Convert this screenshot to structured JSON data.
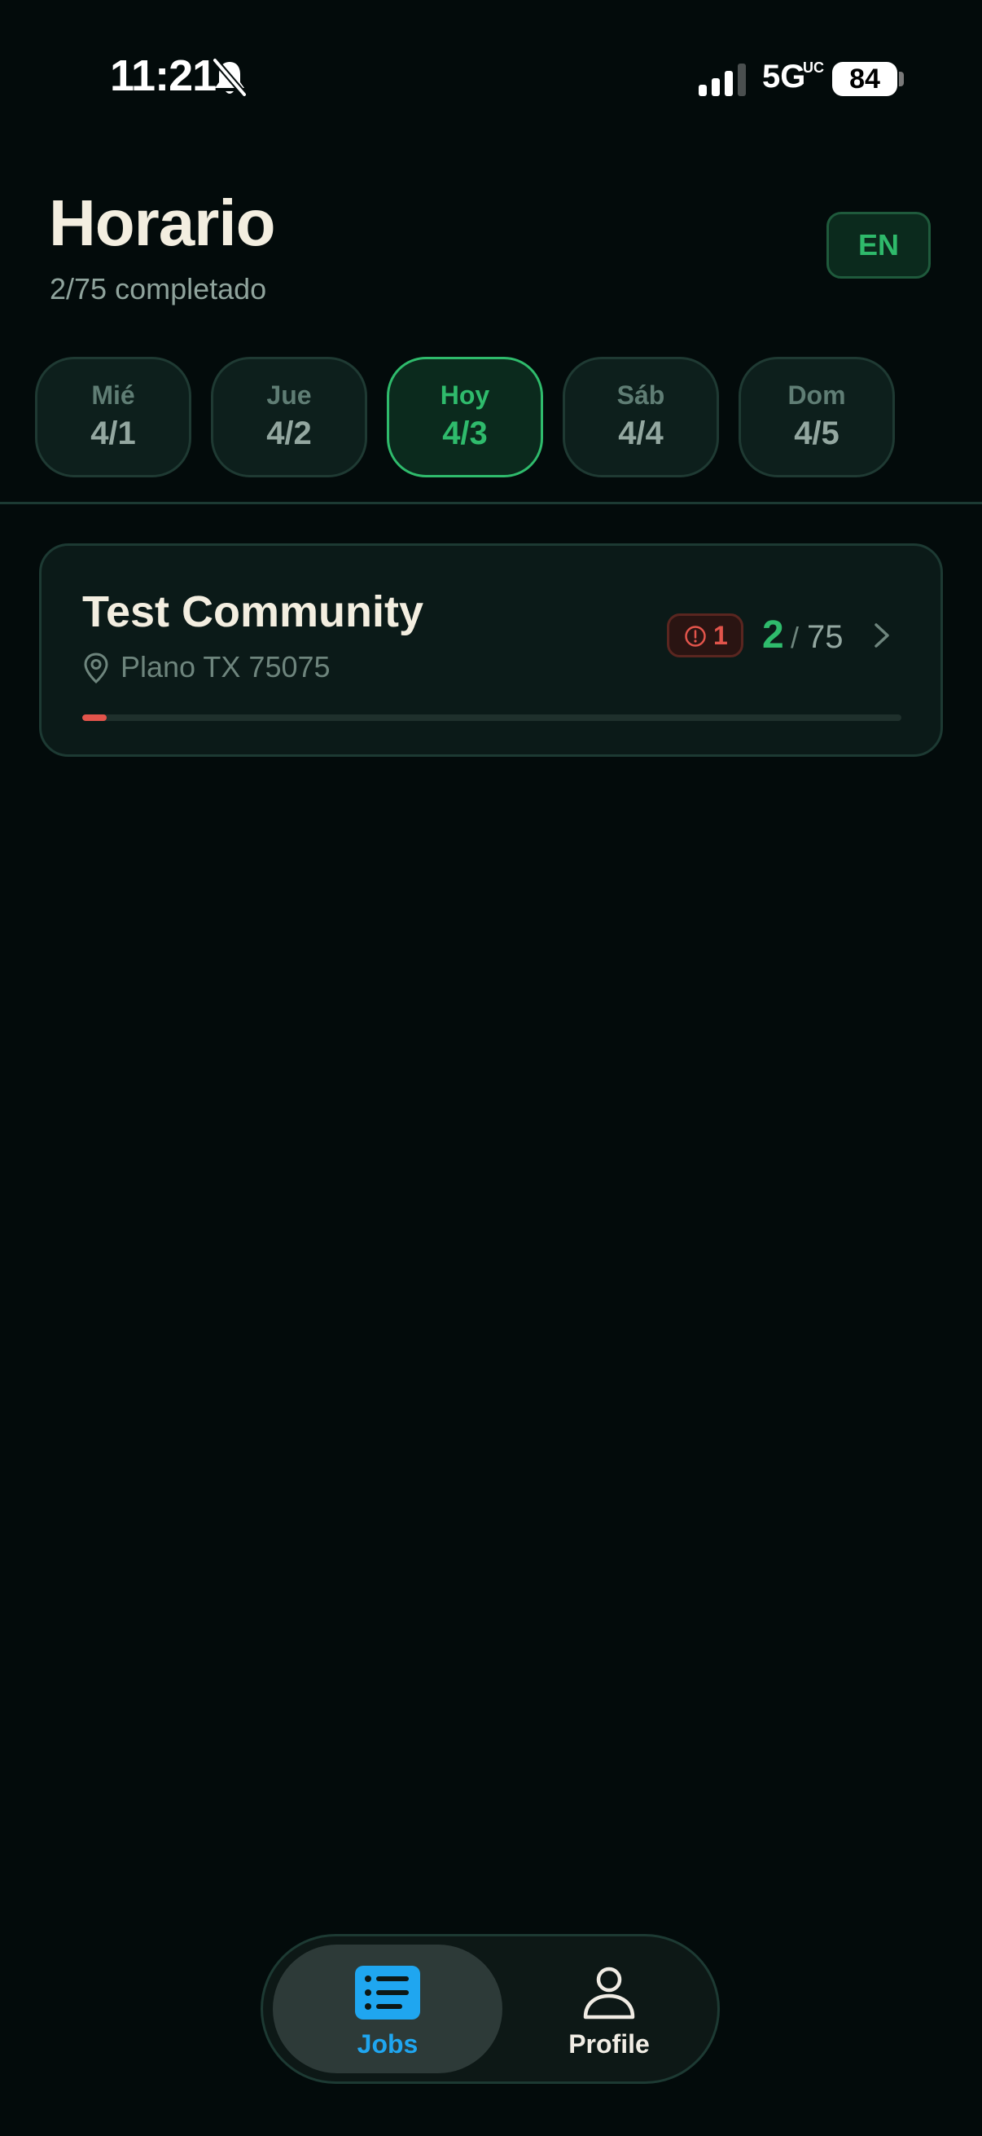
{
  "status_bar": {
    "time": "11:21",
    "network": "5G",
    "network_sub": "UC",
    "battery": "84"
  },
  "header": {
    "title": "Horario",
    "subtitle": "2/75 completado",
    "lang_button": "EN"
  },
  "days": [
    {
      "name": "Mié",
      "date": "4/1",
      "active": false
    },
    {
      "name": "Jue",
      "date": "4/2",
      "active": false
    },
    {
      "name": "Hoy",
      "date": "4/3",
      "active": true
    },
    {
      "name": "Sáb",
      "date": "4/4",
      "active": false
    },
    {
      "name": "Dom",
      "date": "4/5",
      "active": false
    }
  ],
  "job": {
    "title": "Test Community",
    "location": "Plano TX 75075",
    "issues": "1",
    "completed": "2",
    "slash": "/",
    "total": "75",
    "progress_fraction": 0.03
  },
  "nav": {
    "jobs_label": "Jobs",
    "profile_label": "Profile",
    "active": "jobs"
  },
  "icons": {
    "bell": "bell-slash-icon",
    "signal": "signal-icon",
    "pin": "map-pin-icon",
    "alert": "alert-circle-icon",
    "chevron": "chevron-right-icon",
    "jobs": "list-icon",
    "profile": "user-icon"
  },
  "colors": {
    "background": "#030b0b",
    "accent_green": "#2fbb6c",
    "alert_red": "#e2544b",
    "nav_blue": "#1fa6f0"
  }
}
